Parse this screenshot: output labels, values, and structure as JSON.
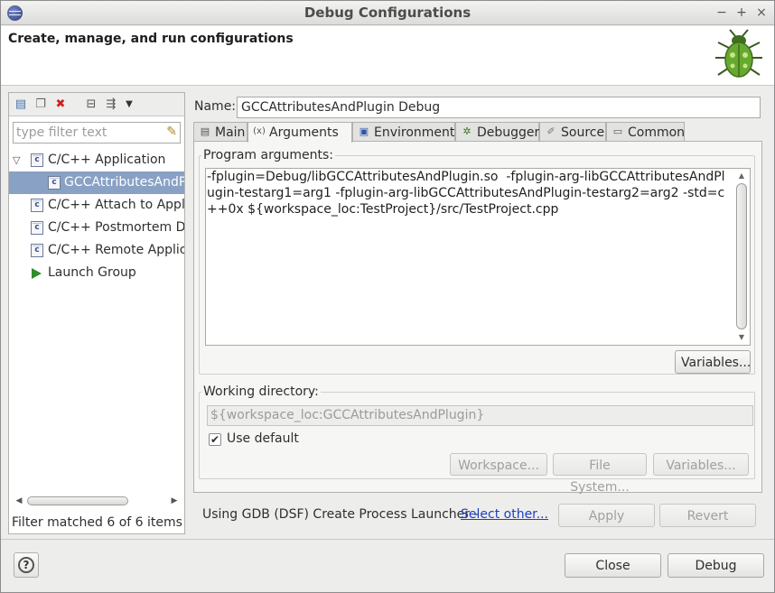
{
  "window": {
    "title": "Debug Configurations",
    "minimize": "−",
    "maximize": "+",
    "close": "×"
  },
  "banner": {
    "heading": "Create, manage, and run configurations"
  },
  "left": {
    "filter_placeholder": "type filter text",
    "tree": [
      {
        "label": "C/C++ Application",
        "icon": "c-file-icon"
      },
      {
        "label": "GCCAttributesAndPlugin Debug",
        "icon": "c-file-icon"
      },
      {
        "label": "C/C++ Attach to Application",
        "icon": "c-file-icon"
      },
      {
        "label": "C/C++ Postmortem Debugger",
        "icon": "c-file-icon"
      },
      {
        "label": "C/C++ Remote Application",
        "icon": "c-file-icon"
      },
      {
        "label": "Launch Group",
        "icon": "launch-group-icon"
      }
    ],
    "status": "Filter matched 6 of 6 items"
  },
  "name": {
    "label": "Name:",
    "value": "GCCAttributesAndPlugin Debug"
  },
  "tabs": [
    {
      "label": "Main"
    },
    {
      "label": "Arguments"
    },
    {
      "label": "Environment"
    },
    {
      "label": "Debugger"
    },
    {
      "label": "Source"
    },
    {
      "label": "Common"
    }
  ],
  "arguments": {
    "program_label": "Program arguments:",
    "program_value": "-fplugin=Debug/libGCCAttributesAndPlugin.so  -fplugin-arg-libGCCAttributesAndPlugin-testarg1=arg1 -fplugin-arg-libGCCAttributesAndPlugin-testarg2=arg2 -std=c++0x ${workspace_loc:TestProject}/src/TestProject.cpp",
    "variables_button": "Variables...",
    "working_dir_label": "Working directory:",
    "working_dir_value": "${workspace_loc:GCCAttributesAndPlugin}",
    "use_default_label": "Use default",
    "use_default_checked": true,
    "workspace_button": "Workspace...",
    "filesystem_button": "File System...",
    "wd_variables_button": "Variables..."
  },
  "footer": {
    "launcher_text": "Using GDB (DSF) Create Process Launcher -",
    "launcher_link": "Select other...",
    "apply_button": "Apply",
    "revert_button": "Revert",
    "close_button": "Close",
    "debug_button": "Debug"
  }
}
